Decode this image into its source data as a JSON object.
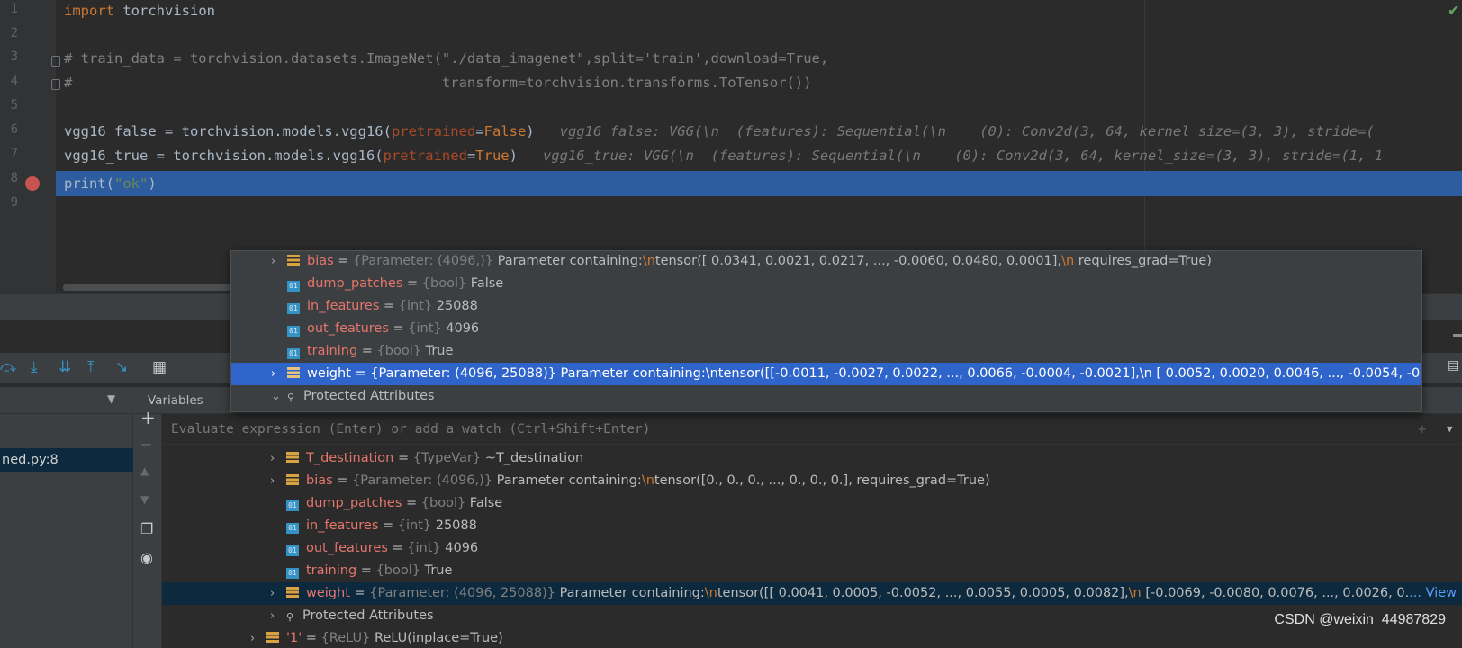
{
  "editor": {
    "line_numbers": [
      "1",
      "2",
      "3",
      "4",
      "5",
      "6",
      "7",
      "8",
      "9"
    ],
    "lines": [
      {
        "kw": "import",
        "text": " torchvision"
      },
      {
        "text": "# train_data = torchvision.datasets.ImageNet(\"./data_imagenet\",split='train',download=True,"
      },
      {
        "text": "#                                            transform=torchvision.transforms.ToTensor())"
      },
      {
        "a": "vgg16_false = torchvision.models.vgg16(",
        "param": "pretrained",
        "eq": "=",
        "kwval": "False",
        "close": ")",
        "inline": "vgg16_false: VGG(\\n  (features): Sequential(\\n    (0): Conv2d(3, 64, kernel_size=(3, 3), stride=("
      },
      {
        "a": "vgg16_true = torchvision.models.vgg16(",
        "param": "pretrained",
        "eq": "=",
        "kwval": "True",
        "close": ")",
        "inline": "vgg16_true: VGG(\\n  (features): Sequential(\\n    (0): Conv2d(3, 64, kernel_size=(3, 3), stride=(1, 1"
      },
      {
        "fn": "print(",
        "str": "\"ok\"",
        "close": ")"
      }
    ],
    "status_icon": "checkmark-icon"
  },
  "debug": {
    "variables_tab": "Variables",
    "frame": "ned.py:8",
    "watch_placeholder": "Evaluate expression (Enter) or add a watch (Ctrl+Shift+Enter)",
    "tree": [
      {
        "expand": "›",
        "name": "T_destination",
        "type": "{TypeVar}",
        "value": " ~T_destination",
        "icon": "field"
      },
      {
        "expand": "›",
        "name": "bias",
        "type": "{Parameter: (4096,)}",
        "value": " Parameter containing:",
        "esc": "\\n",
        "tail": "tensor([0., 0., 0.,  ..., 0., 0., 0.], requires_grad=True)",
        "icon": "field"
      },
      {
        "name": "dump_patches",
        "type": "{bool}",
        "value": " False",
        "icon": "prim"
      },
      {
        "name": "in_features",
        "type": "{int}",
        "value": " 25088",
        "icon": "prim"
      },
      {
        "name": "out_features",
        "type": "{int}",
        "value": " 4096",
        "icon": "prim"
      },
      {
        "name": "training",
        "type": "{bool}",
        "value": " True",
        "icon": "prim"
      },
      {
        "expand": "›",
        "name": "weight",
        "type": "{Parameter: (4096, 25088)}",
        "value": " Parameter containing:",
        "esc": "\\n",
        "tail": "tensor([[ 0.0041,  0.0005, -0.0052,  ...,  0.0055,  0.0005,  0.0082],",
        "esc2": "\\n",
        "tail2": "       [-0.0069, -0.0080,  0.0076,  ...,  0.0026,  0.",
        "link": "... View",
        "icon": "field"
      },
      {
        "expand": "›",
        "name": "Protected Attributes",
        "icon": "key"
      },
      {
        "expand": "›",
        "name": "'1'",
        "type": "{ReLU}",
        "value": " ReLU(inplace=True)",
        "icon": "field"
      }
    ],
    "prim_icon_text": "01"
  },
  "popup": {
    "rows": [
      {
        "expand": "›",
        "name": "bias",
        "type": "{Parameter: (4096,)}",
        "value": " Parameter containing:",
        "esc": "\\n",
        "tail": "tensor([ 0.0341,  0.0021,  0.0217,  ..., -0.0060,  0.0480,  0.0001],",
        "esc2": "\\n",
        "tail2": "       requires_grad=True)",
        "icon": "field"
      },
      {
        "name": "dump_patches",
        "type": "{bool}",
        "value": " False",
        "icon": "prim"
      },
      {
        "name": "in_features",
        "type": "{int}",
        "value": " 25088",
        "icon": "prim"
      },
      {
        "name": "out_features",
        "type": "{int}",
        "value": " 4096",
        "icon": "prim"
      },
      {
        "name": "training",
        "type": "{bool}",
        "value": " True",
        "icon": "prim"
      },
      {
        "expand": "›",
        "name": "weight",
        "plain": " = {Parameter: (4096, 25088)} Parameter containing:\\ntensor([[-0.0011, -0.0027,  0.0022,  ...,  0.0066, -0.0004, -0.0021],\\n        [ 0.0052,  0.0020,  0.0046,  ..., -0.0054, -0...",
        "icon": "field"
      },
      {
        "expand": "⌄",
        "name": "Protected Attributes",
        "icon": "key"
      }
    ]
  },
  "watermark": "CSDN @weixin_44987829",
  "colors": {
    "exec_line": "#2d5d9e",
    "selection": "#0d293e",
    "popup_selection": "#2f65ca",
    "breakpoint": "#c75450"
  }
}
